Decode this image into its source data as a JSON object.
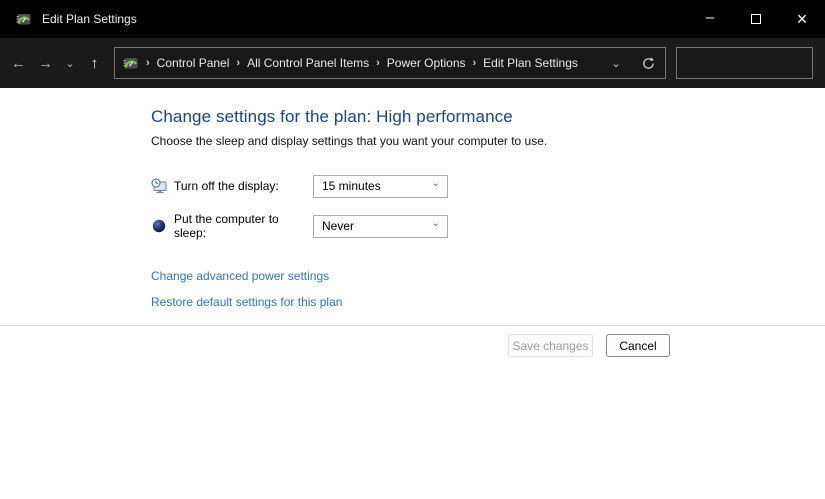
{
  "titlebar": {
    "title": "Edit Plan Settings",
    "minimize_glyph": "–",
    "close_glyph": "×"
  },
  "navbar": {
    "back_glyph": "←",
    "forward_glyph": "→",
    "recent_glyph": "⌄",
    "up_glyph": "↑",
    "breadcrumb": {
      "separator_glyph": "›",
      "items": [
        "Control Panel",
        "All Control Panel Items",
        "Power Options",
        "Edit Plan Settings"
      ]
    },
    "address_dropdown_glyph": "⌄",
    "search": {
      "value": "",
      "placeholder": ""
    }
  },
  "main": {
    "heading": "Change settings for the plan: High performance",
    "subtitle": "Choose the sleep and display settings that you want your computer to use.",
    "combo_chevron_glyph": "⌄",
    "settings": [
      {
        "icon": "display-clock-icon",
        "label": "Turn off the display:",
        "value": "15 minutes"
      },
      {
        "icon": "sleep-icon",
        "label": "Put the computer to sleep:",
        "value": "Never"
      }
    ],
    "links": [
      "Change advanced power settings",
      "Restore default settings for this plan"
    ]
  },
  "footer": {
    "save_label": "Save changes",
    "save_disabled": "true",
    "cancel_label": "Cancel"
  },
  "colors": {
    "titlebar_bg": "#000000",
    "navbar_bg": "#1b1b1b",
    "heading": "#19477e",
    "link": "#3673b5",
    "separator": "#d9d9d9",
    "combo_border": "#acacac"
  }
}
